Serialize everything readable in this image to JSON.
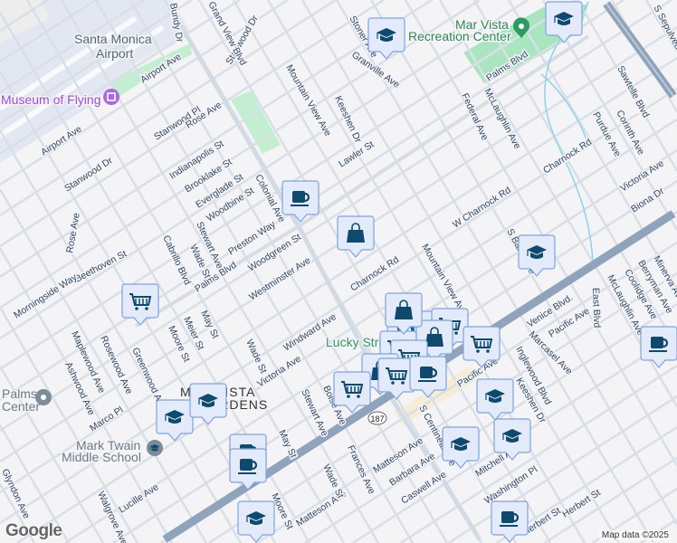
{
  "map": {
    "places": {
      "airport_line1": "Santa Monica",
      "airport_line2": "Airport",
      "museum": "Museum of Flying",
      "rec_line1": "Mar Vista",
      "rec_line2": "Recreation Center",
      "lucky": "Lucky Stri",
      "palms_line1": "Palms",
      "palms_line2": "Center",
      "twain_line1": "Mark Twain",
      "twain_line2": "Middle School",
      "neighborhood_line1": "MAR VISTA",
      "neighborhood_line2": "GARDENS"
    },
    "streets": [
      "Airport Ave",
      "Airport Ave",
      "Stanwood Dr",
      "Stanwood Pl",
      "Rose Ave",
      "Indianapolis St",
      "Brooklake St",
      "Everglade St",
      "Woodbine St",
      "Preston Way",
      "Woodgreen St",
      "Westminster Ave",
      "Palms Blvd",
      "Beethoven St",
      "Morningside Way",
      "Stanwood Dr",
      "Rose Ave",
      "Cabrillo Blvd",
      "Wade St",
      "Stewart Ave",
      "Colonial Ave",
      "Mountain View Ave",
      "Keeshen Dr",
      "Lawler St",
      "Granville Ave",
      "Stoner Ave",
      "Federal Ave",
      "McLaughlin Ave",
      "Palms Blvd",
      "Charnock Rd",
      "W Charnock Rd",
      "Charnock Rd",
      "Sawtelle Blvd",
      "Purdue Ave",
      "Corinth Ave",
      "Victoria Ave",
      "Biona Dr",
      "Mountain View Ave",
      "S Barry Ave",
      "Venice Blvd.",
      "Pacific Ave",
      "Pacific Ave",
      "Marcasel Ave",
      "East Blvd",
      "McLaughlin Ave",
      "Coolidge Ave",
      "Berryman Ave",
      "Minerva Ave",
      "Inglewood Blvd",
      "Keeshen Dr",
      "Windward Ave",
      "Victoria Ave",
      "Meier St",
      "Moore St",
      "May St",
      "Wade St",
      "Stewart Ave",
      "Boise Ave",
      "Marco Pl",
      "Maplewood Ave",
      "Ashwood Ave",
      "Rosewood Ave",
      "Greenwood Ave",
      "May St",
      "Moore St",
      "Lucille Ave",
      "Walgrove Ave",
      "Glyndon Ave",
      "Matteson Ave",
      "Matteson Ave",
      "Frances Ave",
      "Wade St",
      "Barbara Ave",
      "Caswell Ave",
      "S Centinela Ave",
      "Mitchell Ave",
      "Washington Pl",
      "Herbert St",
      "Herbert St",
      "S Sepulveda Blvd",
      "Grand View Blvd",
      "Bundy Dr"
    ],
    "route_shield": "187",
    "markers": [
      "school",
      "school",
      "coffee",
      "bag",
      "school",
      "cart",
      "school",
      "school",
      "coffee",
      "coffee",
      "bag",
      "cart",
      "cart",
      "coffee",
      "school",
      "school",
      "school",
      "coffee",
      "school",
      "coffee"
    ],
    "colors": {
      "marker_fill": "#e3ebfb",
      "marker_border": "#7ea3e0",
      "icon": "#0d4a6e",
      "park": "#c3eed1",
      "major_road": "#8fa3ba"
    }
  },
  "footer": {
    "logo": "Google",
    "credit": "Map data ©2025"
  }
}
